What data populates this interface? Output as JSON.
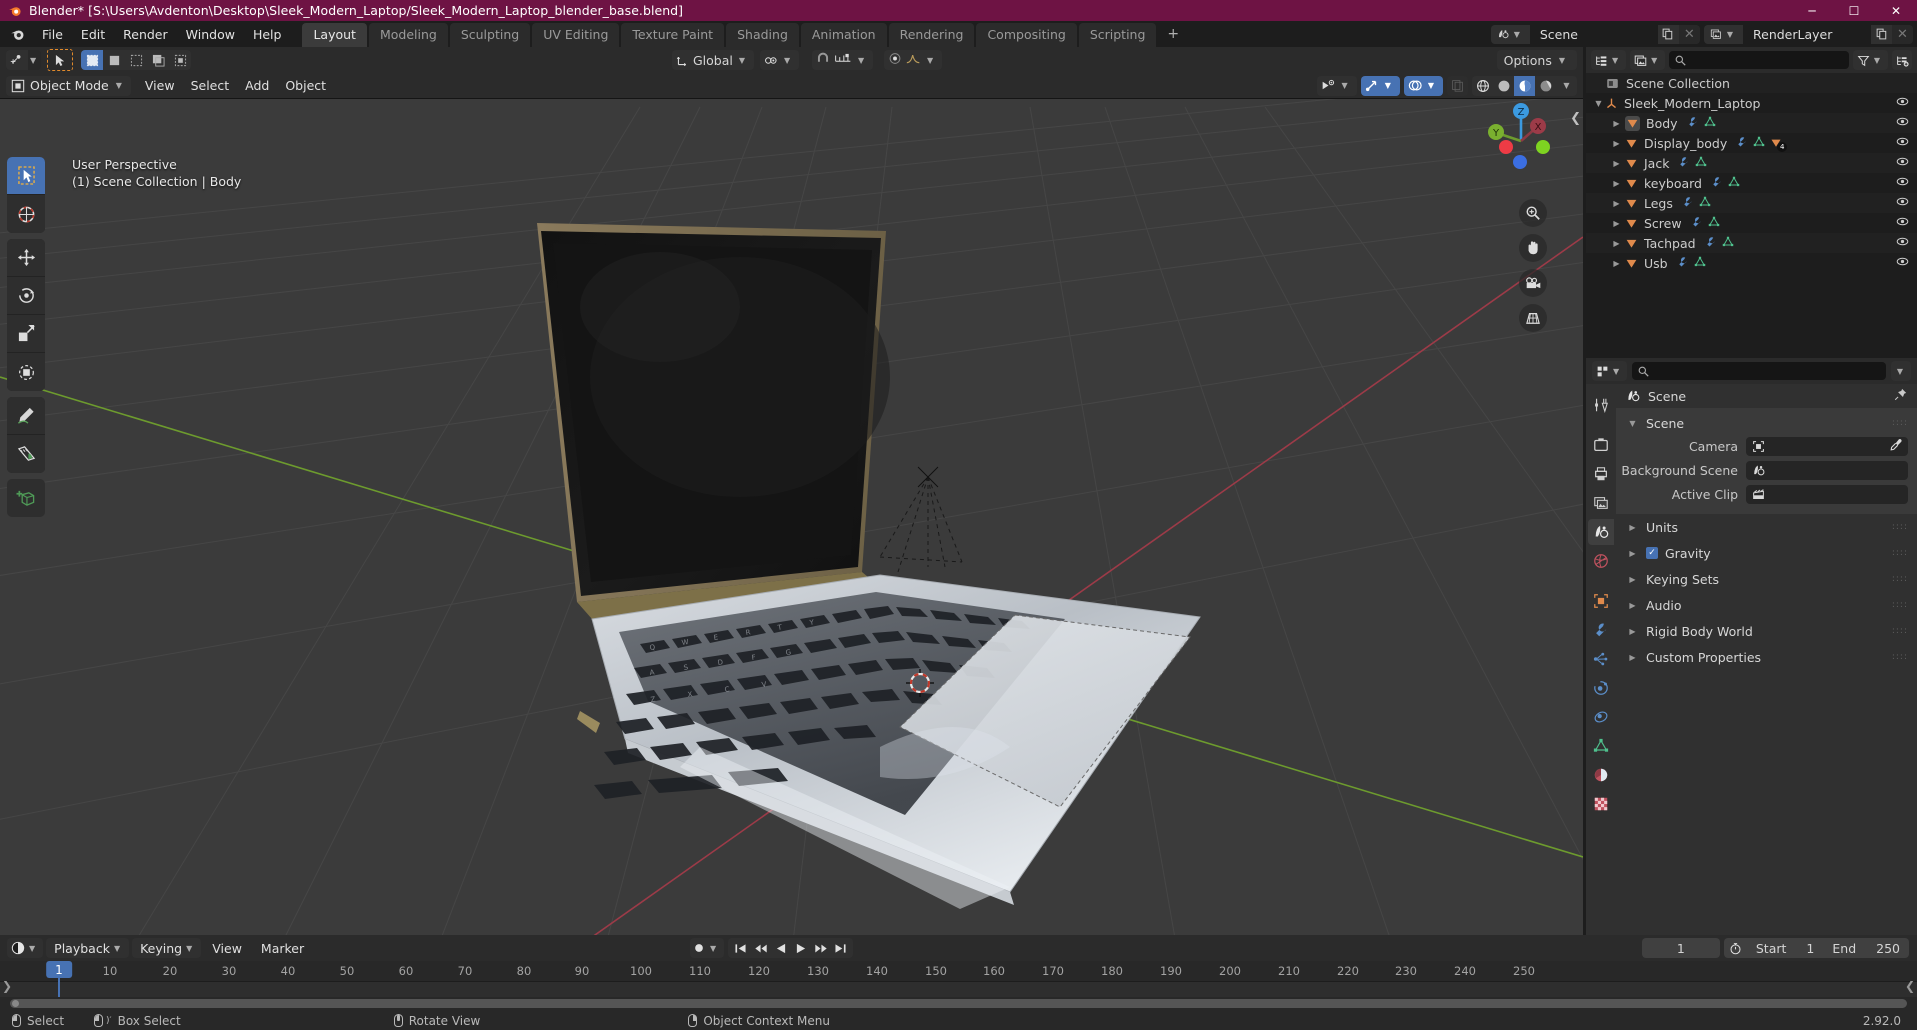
{
  "window": {
    "title": "Blender* [S:\\Users\\Avdenton\\Desktop\\Sleek_Modern_Laptop/Sleek_Modern_Laptop_blender_base.blend]",
    "minimize": "─",
    "maximize": "☐",
    "close": "✕"
  },
  "topbar": {
    "menus": [
      "File",
      "Edit",
      "Render",
      "Window",
      "Help"
    ],
    "workspaces": [
      {
        "label": "Layout",
        "active": true
      },
      {
        "label": "Modeling",
        "active": false
      },
      {
        "label": "Sculpting",
        "active": false
      },
      {
        "label": "UV Editing",
        "active": false
      },
      {
        "label": "Texture Paint",
        "active": false
      },
      {
        "label": "Shading",
        "active": false
      },
      {
        "label": "Animation",
        "active": false
      },
      {
        "label": "Rendering",
        "active": false
      },
      {
        "label": "Compositing",
        "active": false
      },
      {
        "label": "Scripting",
        "active": false
      }
    ],
    "add_workspace": "+",
    "scene_name": "Scene",
    "viewlayer_name": "RenderLayer"
  },
  "viewport": {
    "mode": "Object Mode",
    "menus": [
      "View",
      "Select",
      "Add",
      "Object"
    ],
    "transform_orientation": "Global",
    "options_label": "Options",
    "overlay_line1": "User Perspective",
    "overlay_line2": "(1) Scene Collection | Body",
    "gizmo_axes": [
      "X",
      "Y",
      "Z"
    ],
    "tools": [
      {
        "name": "tweak-tool",
        "active": true
      },
      {
        "name": "cursor-tool",
        "active": false
      },
      {
        "name": "move-tool",
        "active": false
      },
      {
        "name": "rotate-tool",
        "active": false
      },
      {
        "name": "scale-tool",
        "active": false
      },
      {
        "name": "transform-tool",
        "active": false
      },
      {
        "name": "annotate-tool",
        "active": false
      },
      {
        "name": "measure-tool",
        "active": false
      },
      {
        "name": "add-cube-tool",
        "active": false
      }
    ]
  },
  "outliner": {
    "root": "Scene Collection",
    "items": [
      {
        "label": "Sleek_Modern_Laptop",
        "level": 0,
        "type": "empty",
        "expanded": true,
        "icons": []
      },
      {
        "label": "Body",
        "level": 1,
        "type": "mesh",
        "selected": true,
        "icons": [
          "modifier",
          "mesh-data"
        ]
      },
      {
        "label": "Display_body",
        "level": 1,
        "type": "mesh",
        "icons": [
          "modifier",
          "mesh-data",
          "mesh-users"
        ],
        "badge": "4"
      },
      {
        "label": "Jack",
        "level": 1,
        "type": "mesh",
        "icons": [
          "modifier",
          "mesh-data"
        ]
      },
      {
        "label": "keyboard",
        "level": 1,
        "type": "mesh",
        "icons": [
          "modifier",
          "mesh-data"
        ]
      },
      {
        "label": "Legs",
        "level": 1,
        "type": "mesh",
        "icons": [
          "modifier",
          "mesh-data"
        ]
      },
      {
        "label": "Screw",
        "level": 1,
        "type": "mesh",
        "icons": [
          "modifier",
          "mesh-data"
        ]
      },
      {
        "label": "Tachpad",
        "level": 1,
        "type": "mesh",
        "icons": [
          "modifier",
          "mesh-data"
        ]
      },
      {
        "label": "Usb",
        "level": 1,
        "type": "mesh",
        "icons": [
          "modifier",
          "mesh-data"
        ]
      }
    ]
  },
  "properties": {
    "breadcrumb": "Scene",
    "tabs": [
      {
        "name": "tool",
        "active": false
      },
      {
        "name": "render",
        "active": false
      },
      {
        "name": "output",
        "active": false
      },
      {
        "name": "view-layer",
        "active": false
      },
      {
        "name": "scene",
        "active": true
      },
      {
        "name": "world",
        "active": false
      },
      {
        "name": "object",
        "active": false
      },
      {
        "name": "modifiers",
        "active": false
      },
      {
        "name": "particles",
        "active": false
      },
      {
        "name": "physics",
        "active": false
      },
      {
        "name": "constraints",
        "active": false
      },
      {
        "name": "object-data",
        "active": false
      },
      {
        "name": "material",
        "active": false
      },
      {
        "name": "texture",
        "active": false
      }
    ],
    "panels": [
      {
        "label": "Scene",
        "open": true
      },
      {
        "label": "Units",
        "open": false
      },
      {
        "label": "Gravity",
        "open": false,
        "checkbox": true
      },
      {
        "label": "Keying Sets",
        "open": false
      },
      {
        "label": "Audio",
        "open": false
      },
      {
        "label": "Rigid Body World",
        "open": false
      },
      {
        "label": "Custom Properties",
        "open": false
      }
    ],
    "scene_fields": [
      {
        "label": "Camera",
        "value": "",
        "icon": "camera-object-icon",
        "eyedropper": true
      },
      {
        "label": "Background Scene",
        "value": "",
        "icon": "scene-icon",
        "eyedropper": false
      },
      {
        "label": "Active Clip",
        "value": "",
        "icon": "clip-icon",
        "eyedropper": false
      }
    ]
  },
  "timeline": {
    "menus": [
      "Playback",
      "Keying",
      "View",
      "Marker"
    ],
    "current_frame": "1",
    "start_label": "Start",
    "start_value": "1",
    "end_label": "End",
    "end_value": "250",
    "ticks": [
      "10",
      "20",
      "30",
      "40",
      "50",
      "60",
      "70",
      "80",
      "90",
      "100",
      "110",
      "120",
      "130",
      "140",
      "150",
      "160",
      "170",
      "180",
      "190",
      "200",
      "210",
      "220",
      "230",
      "240",
      "250"
    ],
    "playhead_label": "1"
  },
  "statusbar": {
    "items": [
      {
        "mouse": "left",
        "label": "Select"
      },
      {
        "mouse": "left-drag",
        "label": "Box Select"
      },
      {
        "mouse": "middle",
        "label": "Rotate View"
      },
      {
        "mouse": "right",
        "label": "Object Context Menu"
      }
    ],
    "version": "2.92.0"
  },
  "colors": {
    "title_bar": "#6e1344",
    "accent_blue": "#4772b3",
    "viewport_bg": "#3b3b3b",
    "axis_x": "#cc3344",
    "axis_y": "#87c532",
    "mesh_orange": "#e08a4c"
  }
}
